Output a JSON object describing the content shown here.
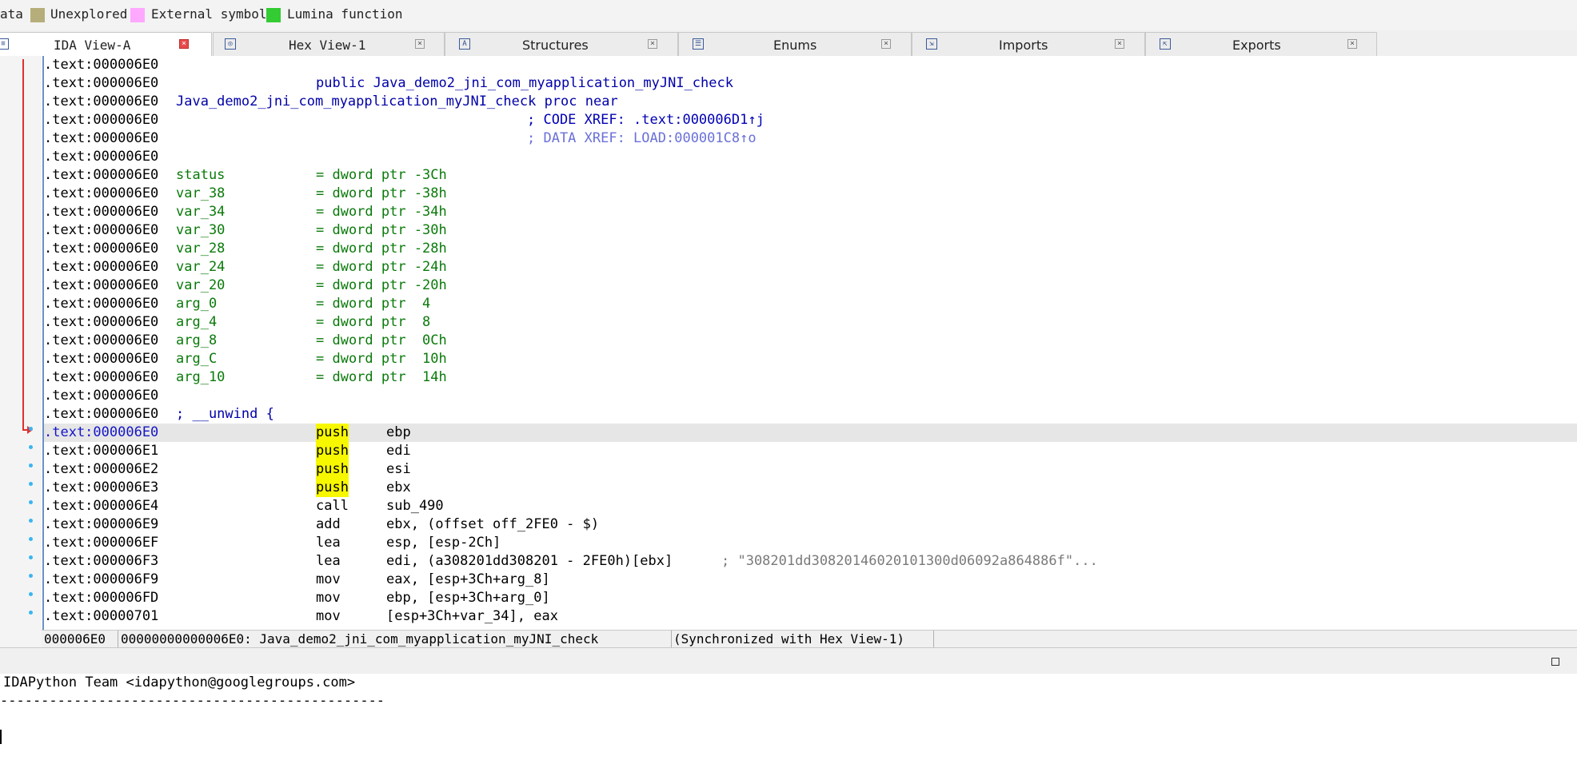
{
  "legend": [
    {
      "label": "ata",
      "color": ""
    },
    {
      "label": "Unexplored",
      "color": "#b5ae7a"
    },
    {
      "label": "External symbol",
      "color": "#ffa8ff"
    },
    {
      "label": "Lumina function",
      "color": "#33cc33"
    }
  ],
  "tabs": [
    {
      "label": "IDA View-A",
      "icon": "graph-icon",
      "active": true
    },
    {
      "label": "Hex View-1",
      "icon": "hex-icon",
      "active": false
    },
    {
      "label": "Structures",
      "icon": "structures-icon",
      "active": false
    },
    {
      "label": "Enums",
      "icon": "enums-icon",
      "active": false
    },
    {
      "label": "Imports",
      "icon": "imports-icon",
      "active": false
    },
    {
      "label": "Exports",
      "icon": "exports-icon",
      "active": false
    }
  ],
  "lines": [
    {
      "addr": ".text:000006E0",
      "label": "",
      "body": ""
    },
    {
      "addr": ".text:000006E0",
      "label": "",
      "body": "public Java_demo2_jni_com_myapplication_myJNI_check"
    },
    {
      "addr": ".text:000006E0",
      "label": "Java_demo2_jni_com_myapplication_myJNI_check proc near",
      "body": ""
    },
    {
      "addr": ".text:000006E0",
      "comment": "; CODE XREF: .text:000006D1↑j"
    },
    {
      "addr": ".text:000006E0",
      "comment": "; DATA XREF: LOAD:000001C8↑o"
    },
    {
      "addr": ".text:000006E0",
      "label": "",
      "body": ""
    },
    {
      "addr": ".text:000006E0",
      "var": "status",
      "def": "= dword ptr -3Ch"
    },
    {
      "addr": ".text:000006E0",
      "var": "var_38",
      "def": "= dword ptr -38h"
    },
    {
      "addr": ".text:000006E0",
      "var": "var_34",
      "def": "= dword ptr -34h"
    },
    {
      "addr": ".text:000006E0",
      "var": "var_30",
      "def": "= dword ptr -30h"
    },
    {
      "addr": ".text:000006E0",
      "var": "var_28",
      "def": "= dword ptr -28h"
    },
    {
      "addr": ".text:000006E0",
      "var": "var_24",
      "def": "= dword ptr -24h"
    },
    {
      "addr": ".text:000006E0",
      "var": "var_20",
      "def": "= dword ptr -20h"
    },
    {
      "addr": ".text:000006E0",
      "var": "arg_0",
      "def": "= dword ptr  4"
    },
    {
      "addr": ".text:000006E0",
      "var": "arg_4",
      "def": "= dword ptr  8"
    },
    {
      "addr": ".text:000006E0",
      "var": "arg_8",
      "def": "= dword ptr  0Ch"
    },
    {
      "addr": ".text:000006E0",
      "var": "arg_C",
      "def": "= dword ptr  10h"
    },
    {
      "addr": ".text:000006E0",
      "var": "arg_10",
      "def": "= dword ptr  14h"
    },
    {
      "addr": ".text:000006E0",
      "label": "",
      "body": ""
    },
    {
      "addr": ".text:000006E0",
      "label": "; __unwind {",
      "body": ""
    },
    {
      "addr": ".text:000006E0",
      "mnem": "push",
      "ops": "ebp"
    },
    {
      "addr": ".text:000006E1",
      "mnem": "push",
      "ops": "edi"
    },
    {
      "addr": ".text:000006E2",
      "mnem": "push",
      "ops": "esi"
    },
    {
      "addr": ".text:000006E3",
      "mnem": "push",
      "ops": "ebx"
    },
    {
      "addr": ".text:000006E4",
      "mnem": "call",
      "ops": "sub_490"
    },
    {
      "addr": ".text:000006E9",
      "mnem": "add",
      "ops": "ebx, (offset off_2FE0 - $)"
    },
    {
      "addr": ".text:000006EF",
      "mnem": "lea",
      "ops": "esp, [esp-2Ch]"
    },
    {
      "addr": ".text:000006F3",
      "mnem": "lea",
      "ops": "edi, (a308201dd308201 - 2FE0h)[ebx]",
      "str": "; \"308201dd30820146020101300d06092a864886f\"..."
    },
    {
      "addr": ".text:000006F9",
      "mnem": "mov",
      "ops": "eax, [esp+3Ch+arg_8]"
    },
    {
      "addr": ".text:000006FD",
      "mnem": "mov",
      "ops": "ebp, [esp+3Ch+arg_0]"
    },
    {
      "addr": ".text:00000701",
      "mnem": "mov",
      "ops": "[esp+3Ch+var_34], eax"
    }
  ],
  "status": {
    "offset": "000006E0",
    "location": "00000000000006E0: Java_demo2_jni_com_myapplication_myJNI_check",
    "sync": "(Synchronized with Hex View-1)"
  },
  "output": {
    "lines": [
      "IDAPython Team <idapython@googlegroups.com>",
      "-----------------------------------------------"
    ]
  }
}
